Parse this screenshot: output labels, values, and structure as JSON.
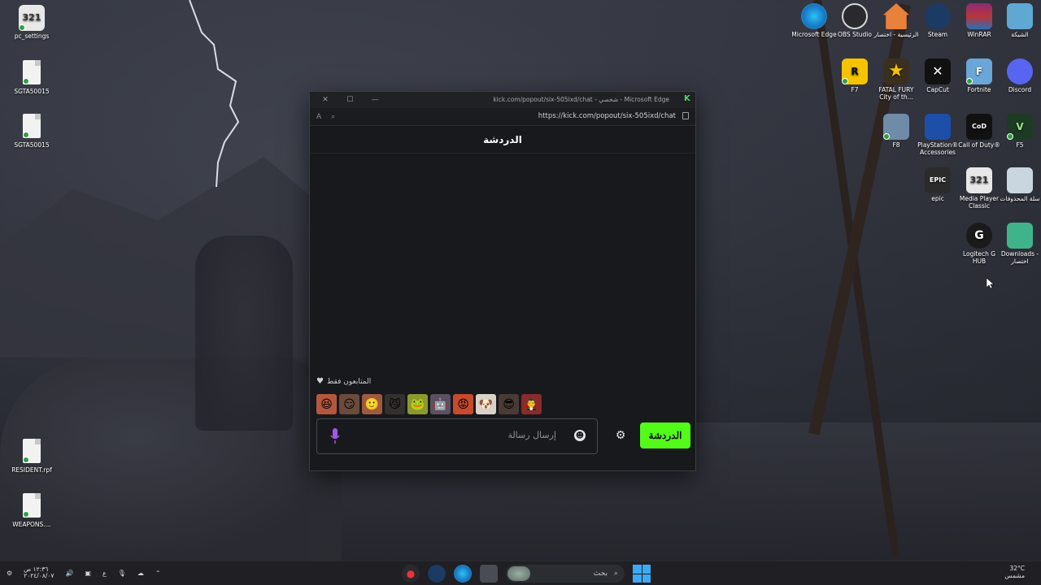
{
  "desktop": {
    "left_icons": [
      {
        "label": "pc_settings",
        "kind": "mpc"
      },
      {
        "label": "SGTA50015",
        "kind": "file"
      },
      {
        "label": "SGTA50015",
        "kind": "file"
      },
      {
        "label": "RESIDENT.rpf",
        "kind": "file"
      },
      {
        "label": "WEAPONS....",
        "kind": "file"
      }
    ],
    "right_icons": [
      {
        "label": "Microsoft Edge",
        "icon": "edge-icon"
      },
      {
        "label": "OBS Studio",
        "icon": "obs-icon"
      },
      {
        "label": "الرئيسية - اختصار",
        "icon": "home-icon"
      },
      {
        "label": "Steam",
        "icon": "steam-icon"
      },
      {
        "label": "WinRAR",
        "icon": "winrar-icon"
      },
      {
        "label": "الشبكة",
        "icon": "network-icon"
      },
      {
        "label": "F7",
        "icon": "rockstar-icon"
      },
      {
        "label": "FATAL FURY City of th...",
        "icon": "star-icon"
      },
      {
        "label": "CapCut",
        "icon": "capcut-icon"
      },
      {
        "label": "Fortnite",
        "icon": "fortnite-icon"
      },
      {
        "label": "Discord",
        "icon": "discord-icon"
      },
      {
        "label": "F8",
        "icon": "city-icon"
      },
      {
        "label": "PlayStation® Accessories",
        "icon": "playstation-icon"
      },
      {
        "label": "Call of Duty®",
        "icon": "cod-icon"
      },
      {
        "label": "F5",
        "icon": "gta5-icon"
      },
      {
        "label": "epic",
        "icon": "epic-icon"
      },
      {
        "label": "Media Player Classic",
        "icon": "mpc-icon"
      },
      {
        "label": "سلة المحذوفات",
        "icon": "recycle-bin-icon"
      },
      {
        "label": "Logitech G HUB",
        "icon": "logitech-icon"
      },
      {
        "label": "Downloads - اختصار",
        "icon": "downloads-folder-icon"
      }
    ]
  },
  "browser": {
    "title": "kick.com/popout/six-505ixd/chat - شخصي - Microsoft Edge",
    "url": "https://kick.com/popout/six-505ixd/chat",
    "chat_header": "الدردشة",
    "followers_only": "المتابعون فقط",
    "message_placeholder": "إرسال رسالة",
    "chat_button": "الدردشة",
    "emotes": [
      "😆",
      "😏",
      "🙂",
      "😼",
      "🐸",
      "🤖",
      "😡",
      "🐶",
      "😎",
      "🧛"
    ]
  },
  "taskbar": {
    "time": "١٢:٣٦ ص",
    "date": "٢٠٢٤/٠٨/٠٧",
    "lang": "ع",
    "search_label": "بحث",
    "weather_temp": "32°C",
    "weather_desc": "مشمس"
  },
  "colors": {
    "kick_green": "#53fc18",
    "accent_blue": "#3da9f5"
  }
}
